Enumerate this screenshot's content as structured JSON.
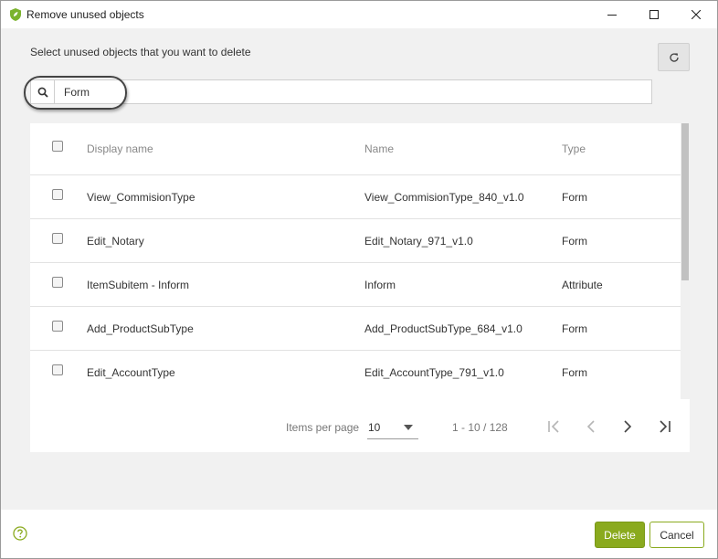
{
  "window": {
    "title": "Remove unused objects",
    "app_icon": "shield-leaf-icon",
    "controls": [
      "minimize-icon",
      "maximize-icon",
      "close-icon"
    ]
  },
  "dialog": {
    "prompt": "Select unused objects that you want to delete",
    "refresh_icon": "refresh-icon"
  },
  "search": {
    "icon": "search-icon",
    "value": "Form",
    "placeholder": ""
  },
  "table": {
    "columns": {
      "display_name": "Display name",
      "name": "Name",
      "type": "Type"
    },
    "rows": [
      {
        "display_name": "View_CommisionType",
        "name": "View_CommisionType_840_v1.0",
        "type": "Form"
      },
      {
        "display_name": "Edit_Notary",
        "name": "Edit_Notary_971_v1.0",
        "type": "Form"
      },
      {
        "display_name": "ItemSubitem - Inform",
        "name": "Inform",
        "type": "Attribute"
      },
      {
        "display_name": "Add_ProductSubType",
        "name": "Add_ProductSubType_684_v1.0",
        "type": "Form"
      },
      {
        "display_name": "Edit_AccountType",
        "name": "Edit_AccountType_791_v1.0",
        "type": "Form"
      }
    ]
  },
  "pager": {
    "items_per_page_label": "Items per page",
    "items_per_page_value": "10",
    "range": "1 - 10 / 128"
  },
  "footer": {
    "help_icon": "help-icon",
    "delete_label": "Delete",
    "cancel_label": "Cancel"
  },
  "colors": {
    "accent": "#8aaa1e",
    "window_bg": "#f1f1f1",
    "panel_bg": "#ffffff"
  }
}
